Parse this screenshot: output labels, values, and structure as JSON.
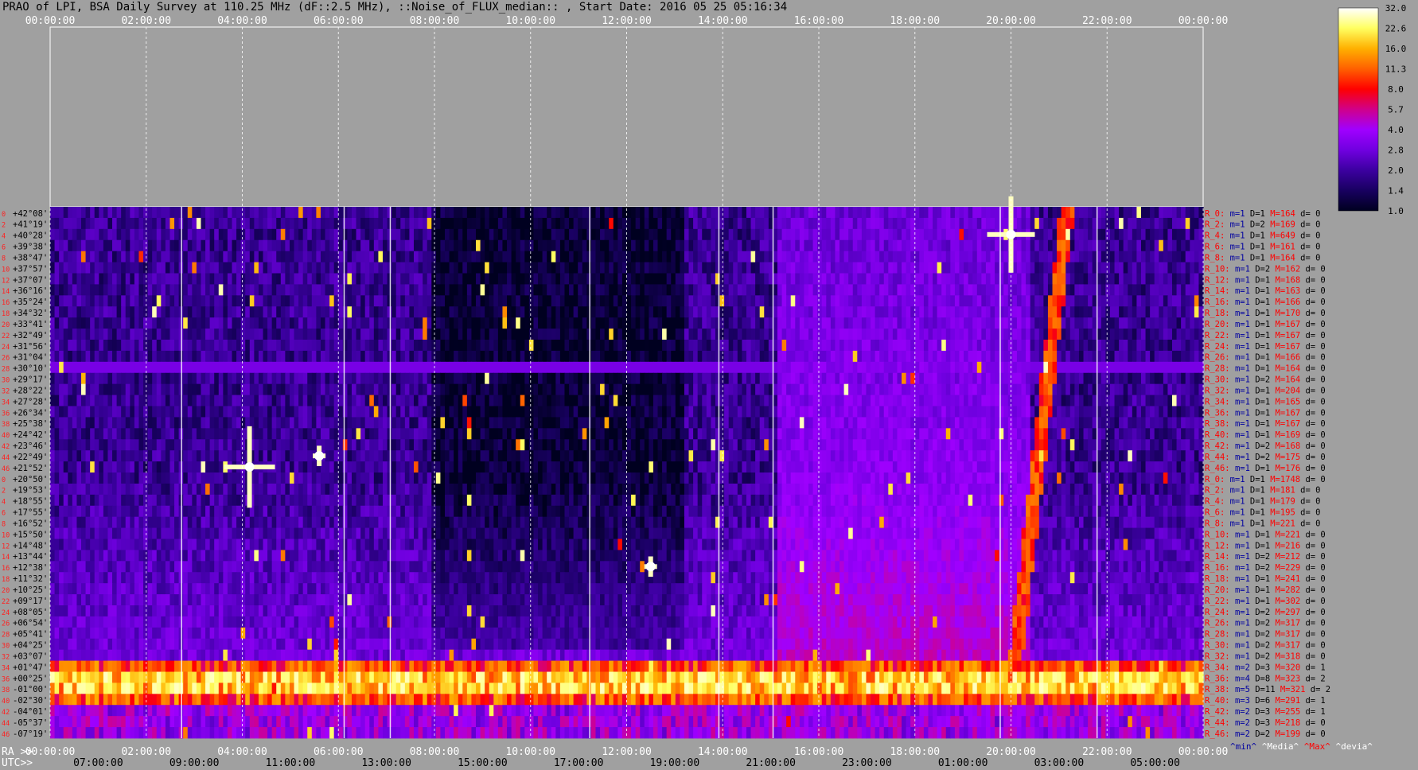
{
  "title": "PRAO of LPI, BSA Daily Survey at 110.25 MHz (dF::2.5 MHz), ::Noise_of_FLUX_median:: , Start Date: 2016 05 25 05:16:34",
  "colorbar": {
    "ticks": [
      "32.0",
      "22.6",
      "16.0",
      "11.3",
      "8.0",
      "5.7",
      "4.0",
      "2.8",
      "2.0",
      "1.4",
      "1.0"
    ],
    "stops": [
      "#ffffff",
      "#ffff60",
      "#ffb000",
      "#ff6000",
      "#ff0000",
      "#d0008a",
      "#a000ff",
      "#7000e0",
      "#3c00a0",
      "#180060",
      "#000020"
    ]
  },
  "top_axis_labels": [
    "00:00:00",
    "02:00:00",
    "04:00:00",
    "06:00:00",
    "08:00:00",
    "10:00:00",
    "12:00:00",
    "14:00:00",
    "16:00:00",
    "18:00:00",
    "20:00:00",
    "22:00:00",
    "00:00:00"
  ],
  "bottom": {
    "ra_prefix": "RA >>",
    "ra_labels": [
      "00:00:00",
      "02:00:00",
      "04:00:00",
      "06:00:00",
      "08:00:00",
      "10:00:00",
      "12:00:00",
      "14:00:00",
      "16:00:00",
      "18:00:00",
      "20:00:00",
      "22:00:00",
      "00:00:00"
    ],
    "utc_prefix": "UTC>>",
    "utc_labels": [
      "07:00:00",
      "09:00:00",
      "11:00:00",
      "13:00:00",
      "15:00:00",
      "17:00:00",
      "19:00:00",
      "21:00:00",
      "23:00:00",
      "01:00:00",
      "03:00:00",
      "05:00:00"
    ]
  },
  "legend": {
    "min": "^min^",
    "median": "^Media^",
    "max": "^Max^",
    "devia": "^devia^"
  },
  "row_numbers": [
    "0",
    "2",
    "4",
    "6",
    "8",
    "10",
    "12",
    "14",
    "16",
    "18",
    "20",
    "22",
    "24",
    "26",
    "28",
    "30",
    "32",
    "34",
    "36",
    "38",
    "40",
    "42",
    "44",
    "46",
    "0",
    "2",
    "4",
    "6",
    "8",
    "10",
    "12",
    "14",
    "16",
    "18",
    "20",
    "22",
    "24",
    "26",
    "28",
    "30",
    "32",
    "34",
    "36",
    "38",
    "40",
    "42",
    "44",
    "46"
  ],
  "declinations": [
    "+42°08'",
    "+41°19'",
    "+40°28'",
    "+39°38'",
    "+38°47'",
    "+37°57'",
    "+37°07'",
    "+36°16'",
    "+35°24'",
    "+34°32'",
    "+33°41'",
    "+32°49'",
    "+31°56'",
    "+31°04'",
    "+30°10'",
    "+29°17'",
    "+28°22'",
    "+27°28'",
    "+26°34'",
    "+25°38'",
    "+24°42'",
    "+23°46'",
    "+22°49'",
    "+21°52'",
    "+20°50'",
    "+19°53'",
    "+18°55'",
    "+17°55'",
    "+16°52'",
    "+15°50'",
    "+14°48'",
    "+13°44'",
    "+12°38'",
    "+11°32'",
    "+10°25'",
    "+09°17'",
    "+08°05'",
    "+06°54'",
    "+05°41'",
    "+04°25'",
    "+03°07'",
    "+01°47'",
    "+00°25'",
    "-01°00'",
    "-02°30'",
    "-04°01'",
    "-05°37'",
    "-07°19'"
  ],
  "stats_rows": [
    {
      "r": "R_0:",
      "m": "1",
      "d": "1",
      "mx": "164",
      "dv": "0"
    },
    {
      "r": "R_2:",
      "m": "1",
      "d": "2",
      "mx": "169",
      "dv": "0"
    },
    {
      "r": "R_4:",
      "m": "1",
      "d": "1",
      "mx": "649",
      "dv": "0"
    },
    {
      "r": "R_6:",
      "m": "1",
      "d": "1",
      "mx": "161",
      "dv": "0"
    },
    {
      "r": "R_8:",
      "m": "1",
      "d": "1",
      "mx": "164",
      "dv": "0"
    },
    {
      "r": "R_10:",
      "m": "1",
      "d": "2",
      "mx": "162",
      "dv": "0"
    },
    {
      "r": "R_12:",
      "m": "1",
      "d": "1",
      "mx": "168",
      "dv": "0"
    },
    {
      "r": "R_14:",
      "m": "1",
      "d": "1",
      "mx": "163",
      "dv": "0"
    },
    {
      "r": "R_16:",
      "m": "1",
      "d": "1",
      "mx": "166",
      "dv": "0"
    },
    {
      "r": "R_18:",
      "m": "1",
      "d": "1",
      "mx": "170",
      "dv": "0"
    },
    {
      "r": "R_20:",
      "m": "1",
      "d": "1",
      "mx": "167",
      "dv": "0"
    },
    {
      "r": "R_22:",
      "m": "1",
      "d": "1",
      "mx": "167",
      "dv": "0"
    },
    {
      "r": "R_24:",
      "m": "1",
      "d": "1",
      "mx": "167",
      "dv": "0"
    },
    {
      "r": "R_26:",
      "m": "1",
      "d": "1",
      "mx": "166",
      "dv": "0"
    },
    {
      "r": "R_28:",
      "m": "1",
      "d": "1",
      "mx": "164",
      "dv": "0"
    },
    {
      "r": "R_30:",
      "m": "1",
      "d": "2",
      "mx": "164",
      "dv": "0"
    },
    {
      "r": "R_32:",
      "m": "1",
      "d": "1",
      "mx": "204",
      "dv": "0"
    },
    {
      "r": "R_34:",
      "m": "1",
      "d": "1",
      "mx": "165",
      "dv": "0"
    },
    {
      "r": "R_36:",
      "m": "1",
      "d": "1",
      "mx": "167",
      "dv": "0"
    },
    {
      "r": "R_38:",
      "m": "1",
      "d": "1",
      "mx": "167",
      "dv": "0"
    },
    {
      "r": "R_40:",
      "m": "1",
      "d": "1",
      "mx": "169",
      "dv": "0"
    },
    {
      "r": "R_42:",
      "m": "1",
      "d": "2",
      "mx": "168",
      "dv": "0"
    },
    {
      "r": "R_44:",
      "m": "1",
      "d": "2",
      "mx": "175",
      "dv": "0"
    },
    {
      "r": "R_46:",
      "m": "1",
      "d": "1",
      "mx": "176",
      "dv": "0"
    },
    {
      "r": "R_0:",
      "m": "1",
      "d": "1",
      "mx": "1748",
      "dv": "0"
    },
    {
      "r": "R_2:",
      "m": "1",
      "d": "1",
      "mx": "181",
      "dv": "0"
    },
    {
      "r": "R_4:",
      "m": "1",
      "d": "1",
      "mx": "179",
      "dv": "0"
    },
    {
      "r": "R_6:",
      "m": "1",
      "d": "1",
      "mx": "195",
      "dv": "0"
    },
    {
      "r": "R_8:",
      "m": "1",
      "d": "1",
      "mx": "221",
      "dv": "0"
    },
    {
      "r": "R_10:",
      "m": "1",
      "d": "1",
      "mx": "221",
      "dv": "0"
    },
    {
      "r": "R_12:",
      "m": "1",
      "d": "1",
      "mx": "216",
      "dv": "0"
    },
    {
      "r": "R_14:",
      "m": "1",
      "d": "2",
      "mx": "212",
      "dv": "0"
    },
    {
      "r": "R_16:",
      "m": "1",
      "d": "2",
      "mx": "229",
      "dv": "0"
    },
    {
      "r": "R_18:",
      "m": "1",
      "d": "1",
      "mx": "241",
      "dv": "0"
    },
    {
      "r": "R_20:",
      "m": "1",
      "d": "1",
      "mx": "282",
      "dv": "0"
    },
    {
      "r": "R_22:",
      "m": "1",
      "d": "1",
      "mx": "302",
      "dv": "0"
    },
    {
      "r": "R_24:",
      "m": "1",
      "d": "2",
      "mx": "297",
      "dv": "0"
    },
    {
      "r": "R_26:",
      "m": "1",
      "d": "2",
      "mx": "317",
      "dv": "0"
    },
    {
      "r": "R_28:",
      "m": "1",
      "d": "2",
      "mx": "317",
      "dv": "0"
    },
    {
      "r": "R_30:",
      "m": "1",
      "d": "2",
      "mx": "317",
      "dv": "0"
    },
    {
      "r": "R_32:",
      "m": "1",
      "d": "2",
      "mx": "318",
      "dv": "0"
    },
    {
      "r": "R_34:",
      "m": "2",
      "d": "3",
      "mx": "320",
      "dv": "1"
    },
    {
      "r": "R_36:",
      "m": "4",
      "d": "8",
      "mx": "323",
      "dv": "2"
    },
    {
      "r": "R_38:",
      "m": "5",
      "d": "11",
      "mx": "321",
      "dv": "2"
    },
    {
      "r": "R_40:",
      "m": "3",
      "d": "6",
      "mx": "291",
      "dv": "1"
    },
    {
      "r": "R_42:",
      "m": "2",
      "d": "3",
      "mx": "255",
      "dv": "1"
    },
    {
      "r": "R_44:",
      "m": "2",
      "d": "3",
      "mx": "218",
      "dv": "0"
    },
    {
      "r": "R_46:",
      "m": "2",
      "d": "2",
      "mx": "199",
      "dv": "0"
    }
  ],
  "chart_data": {
    "type": "heatmap",
    "x_axis_top": "RA 00:00:00 – 24:00:00 (2 h ticks)",
    "rows": 48,
    "color_scale": {
      "min": 1.0,
      "max": 32.0,
      "scale": "log2"
    },
    "features": [
      {
        "kind": "bright_band",
        "rows": "R_34–R_40 (second group)",
        "level": 16.0
      },
      {
        "kind": "point_source",
        "ra": "04:10",
        "dec": "+21°52'",
        "level": 32.0
      },
      {
        "kind": "point_source",
        "ra": "20:00",
        "dec": "+40°28'",
        "level": 32.0
      },
      {
        "kind": "diagonal_trail",
        "ra_start": "19:00",
        "ra_end": "20:00",
        "level": 8.0
      },
      {
        "kind": "horizontal_line",
        "dec": "+30°10'",
        "level": 2.8
      }
    ]
  }
}
